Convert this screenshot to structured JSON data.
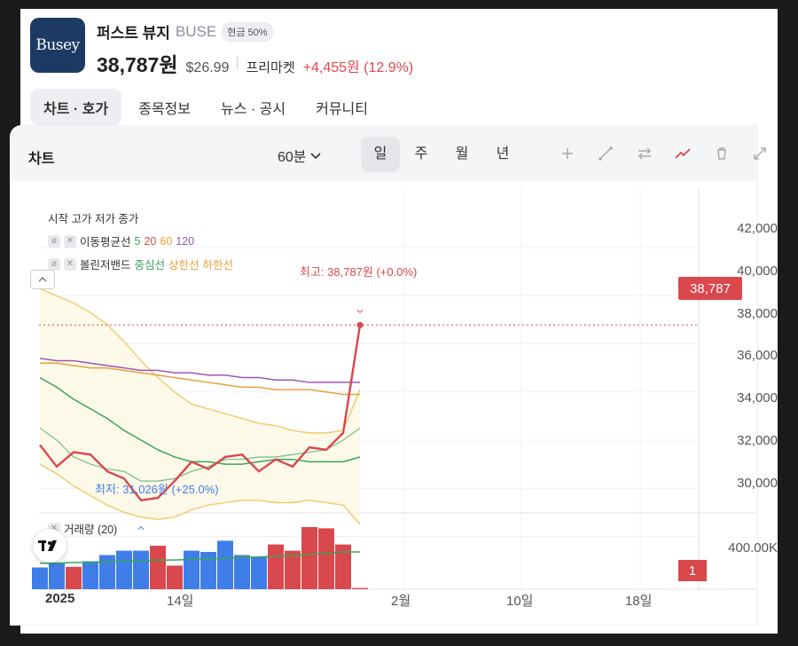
{
  "header": {
    "logo_text": "Busey",
    "name": "퍼스트 뷰지",
    "ticker": "BUSE",
    "badge": "현금 50%",
    "price": "38,787원",
    "usd_price": "$26.99",
    "market": "프리마켓",
    "change": "+4,455원 (12.9%)"
  },
  "tabs": [
    {
      "label": "차트 · 호가",
      "active": true
    },
    {
      "label": "종목정보"
    },
    {
      "label": "뉴스 · 공시"
    },
    {
      "label": "커뮤니티"
    }
  ],
  "toolbar": {
    "title": "차트",
    "interval": "60분",
    "periods": [
      "일",
      "주",
      "월",
      "년"
    ],
    "active_period": "일",
    "tools": [
      "plus-icon",
      "pencil-line-icon",
      "swap-arrows-icon",
      "trend-line-icon",
      "trash-icon",
      "expand-icon"
    ]
  },
  "legend": {
    "ohlc_label": "시작 고가 저가 종가",
    "ma_label": "이동평균선",
    "ma_periods": [
      "5",
      "20",
      "60",
      "120"
    ],
    "bb_label": "볼린저밴드",
    "bb_center": "중심선",
    "bb_upper": "상한선",
    "bb_lower": "하한선",
    "volume_label": "거래량 (20)"
  },
  "annotations": {
    "high": "최고: 38,787원 (+0.0%)",
    "low": "최저: 31,026원 (+25.0%)"
  },
  "price_tag": "38,787",
  "volume_axis_label": "400.00K",
  "volume_tag": "1",
  "colors": {
    "up": "#d9484c",
    "down": "#3f7ee8",
    "ma5": "#3aa35b",
    "ma20": "#d9484c",
    "ma60": "#e6a23c",
    "ma120": "#9b59b6",
    "bb": "#f0c96a"
  },
  "chart_data": {
    "type": "line",
    "x_tick_labels": [
      "2025",
      "14일",
      "2월",
      "10일",
      "18일"
    ],
    "y_tick_labels": [
      "42,000",
      "40,000",
      "38,000",
      "36,000",
      "34,000",
      "32,000",
      "30,000"
    ],
    "ylim": [
      29500,
      43000
    ],
    "series": [
      {
        "name": "종가",
        "values": [
          33800,
          32900,
          33500,
          33400,
          32700,
          32400,
          31500,
          31600,
          32300,
          33100,
          32800,
          33300,
          33400,
          32700,
          33200,
          32900,
          33700,
          33600,
          34300,
          38787
        ]
      },
      {
        "name": "5",
        "values": [
          36600,
          36200,
          35700,
          35300,
          34900,
          34400,
          34000,
          33600,
          33300,
          33100,
          33100,
          33000,
          33000,
          33100,
          33200,
          33200,
          33100,
          33100,
          33100,
          33300
        ]
      },
      {
        "name": "20",
        "values": [
          34500,
          34000,
          33300,
          33000,
          32800,
          32700,
          32300,
          32300,
          32400,
          32700,
          32900,
          33200,
          33200,
          33300,
          33300,
          33400,
          33500,
          33600,
          34000,
          34500
        ]
      },
      {
        "name": "60",
        "values": [
          37200,
          37200,
          37100,
          37000,
          37000,
          36900,
          36800,
          36700,
          36600,
          36500,
          36400,
          36300,
          36200,
          36200,
          36100,
          36100,
          36100,
          36000,
          35900,
          35900
        ]
      },
      {
        "name": "120",
        "values": [
          37400,
          37300,
          37300,
          37200,
          37100,
          37000,
          36900,
          36900,
          36800,
          36800,
          36700,
          36700,
          36600,
          36600,
          36500,
          36500,
          36400,
          36400,
          36400,
          36400
        ]
      },
      {
        "name": "상한선",
        "values": [
          40300,
          40000,
          39700,
          39300,
          38800,
          38100,
          37300,
          36600,
          36000,
          35500,
          35300,
          35100,
          34900,
          34700,
          34600,
          34400,
          34300,
          34300,
          34400,
          36100
        ]
      },
      {
        "name": "하한선",
        "values": [
          33000,
          32600,
          32100,
          31700,
          31300,
          31000,
          30800,
          30700,
          30800,
          31100,
          31300,
          31400,
          31500,
          31500,
          31400,
          31400,
          31500,
          31400,
          31300,
          30500
        ]
      }
    ],
    "volume": {
      "values": [
        0.35,
        0.42,
        0.36,
        0.45,
        0.55,
        0.62,
        0.62,
        0.7,
        0.38,
        0.62,
        0.6,
        0.78,
        0.55,
        0.52,
        0.72,
        0.62,
        1.0,
        0.98,
        0.72,
        0.02
      ],
      "up": [
        false,
        false,
        true,
        false,
        false,
        false,
        false,
        true,
        true,
        false,
        false,
        false,
        false,
        false,
        true,
        true,
        true,
        true,
        true,
        true
      ],
      "ma": [
        0.42,
        0.42,
        0.43,
        0.43,
        0.44,
        0.45,
        0.46,
        0.47,
        0.47,
        0.48,
        0.49,
        0.5,
        0.51,
        0.52,
        0.53,
        0.54,
        0.56,
        0.58,
        0.6,
        0.6
      ]
    }
  }
}
